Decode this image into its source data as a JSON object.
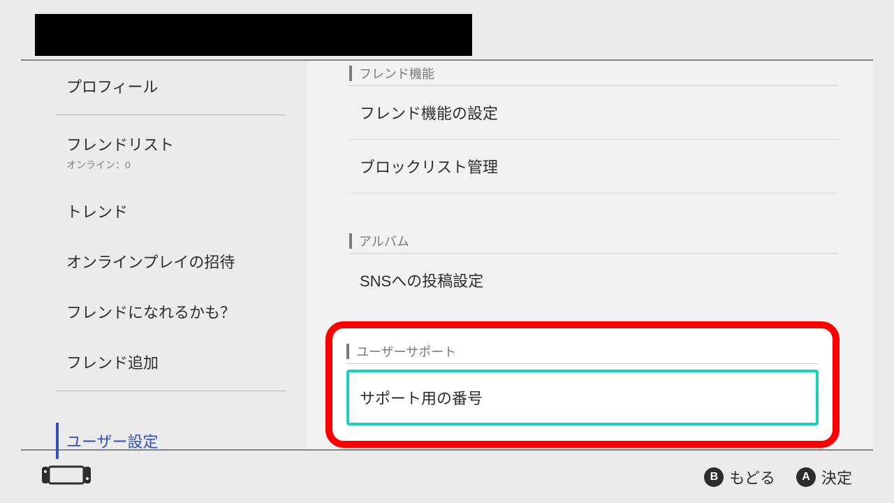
{
  "sidebar": {
    "items": [
      {
        "label": "プロフィール",
        "sub": ""
      },
      {
        "label": "フレンドリスト",
        "sub": "オンライン：0"
      },
      {
        "label": "トレンド",
        "sub": ""
      },
      {
        "label": "オンラインプレイの招待",
        "sub": ""
      },
      {
        "label": "フレンドになれるかも？",
        "sub": ""
      },
      {
        "label": "フレンド追加",
        "sub": ""
      },
      {
        "label": "ユーザー設定",
        "sub": ""
      }
    ]
  },
  "main": {
    "sections": [
      {
        "title": "フレンド機能",
        "items": [
          "フレンド機能の設定",
          "ブロックリスト管理"
        ]
      },
      {
        "title": "アルバム",
        "items": [
          "SNSへの投稿設定"
        ]
      }
    ],
    "highlight": {
      "title": "ユーザーサポート",
      "item": "サポート用の番号"
    }
  },
  "footer": {
    "back": {
      "key": "B",
      "label": "もどる"
    },
    "ok": {
      "key": "A",
      "label": "決定"
    }
  }
}
